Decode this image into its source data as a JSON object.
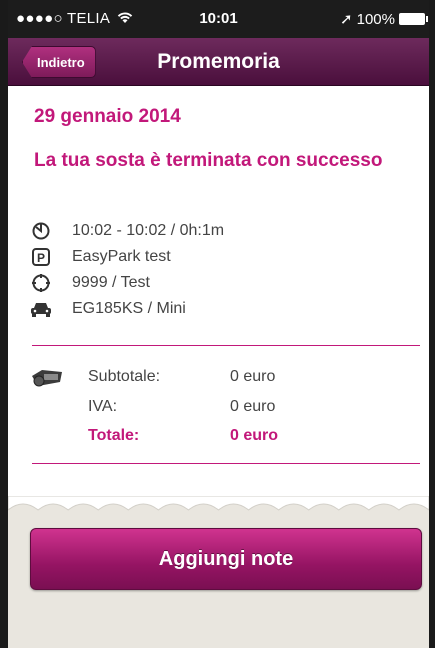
{
  "status_bar": {
    "carrier": "●●●●○ TELIA",
    "wifi_icon": "wifi-icon",
    "time": "10:01",
    "location_icon": "➚",
    "battery": "100%"
  },
  "nav": {
    "back_label": "Indietro",
    "title": "Promemoria"
  },
  "receipt": {
    "date": "29 gennaio 2014",
    "headline": "La tua sosta è terminata con successo",
    "details": [
      {
        "icon": "clock-icon",
        "text": "10:02 - 10:02 / 0h:1m"
      },
      {
        "icon": "parking-icon",
        "text": "EasyPark test"
      },
      {
        "icon": "target-icon",
        "text": "9999 / Test"
      },
      {
        "icon": "car-icon",
        "text": "EG185KS / Mini"
      }
    ],
    "costs_icon": "money-icon",
    "costs": [
      {
        "label": "Subtotale:",
        "value": "0 euro"
      },
      {
        "label": "IVA:",
        "value": "0 euro"
      },
      {
        "label": "Totale:",
        "value": "0 euro"
      }
    ]
  },
  "actions": {
    "add_notes_label": "Aggiungi note"
  },
  "colors": {
    "accent": "#c2187a",
    "nav_bg": "#4a0f3c",
    "background": "#e9e6df"
  }
}
